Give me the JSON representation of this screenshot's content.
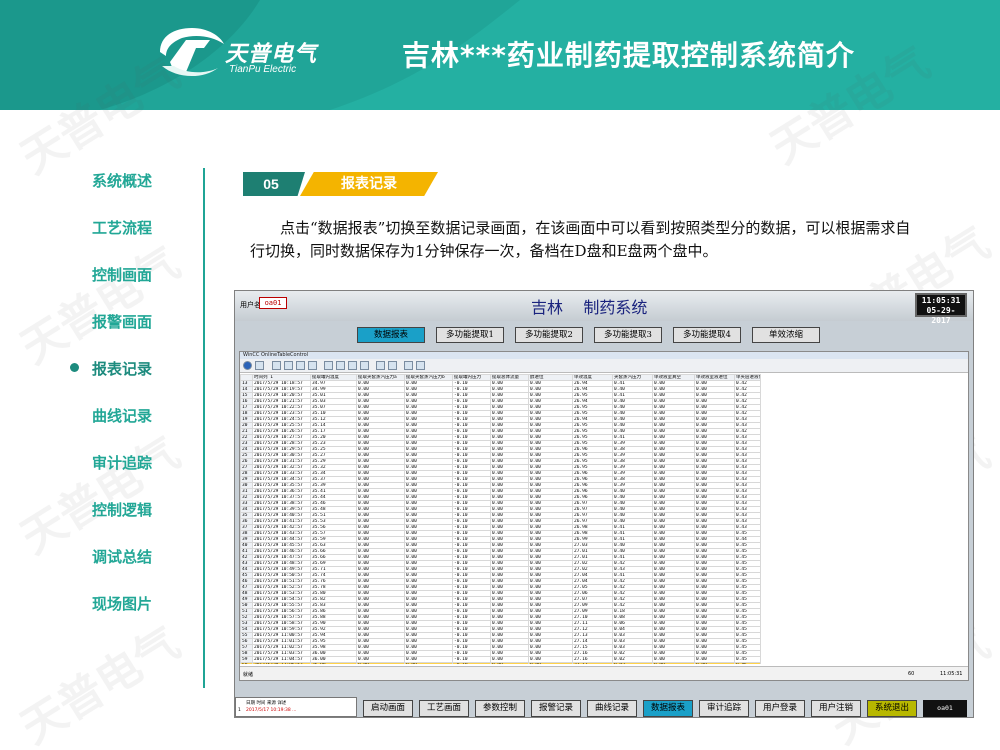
{
  "slide": {
    "title": "吉林***药业制药提取控制系统简介",
    "logo_name": "天普电气",
    "logo_sub": "TianPu Electric",
    "watermark": "天普电气",
    "section_number": "05",
    "section_title": "报表记录",
    "paragraph": "点击“数据报表”切换至数据记录画面，在该画面中可以看到按照类型分的数据，可以根据需求自行切换，同时数据保存为1分钟保存一次，备档在D盘和E盘两个盘中。",
    "accent_color": "#24b0a2",
    "section_color": "#f4b400"
  },
  "nav": {
    "items": [
      {
        "label": "系统概述",
        "active": false
      },
      {
        "label": "工艺流程",
        "active": false
      },
      {
        "label": "控制画面",
        "active": false
      },
      {
        "label": "报警画面",
        "active": false
      },
      {
        "label": "报表记录",
        "active": true
      },
      {
        "label": "曲线记录",
        "active": false
      },
      {
        "label": "审计追踪",
        "active": false
      },
      {
        "label": "控制逻辑",
        "active": false
      },
      {
        "label": "调试总结",
        "active": false
      },
      {
        "label": "现场图片",
        "active": false
      }
    ]
  },
  "app": {
    "user_label": "用户名",
    "user_value": "oa01",
    "title": "吉林    制药系统",
    "clock_time": "11:05:31",
    "clock_date": "05-29-2017",
    "menu_buttons": [
      "数据报表",
      "多功能提取1",
      "多功能提取2",
      "多功能提取3",
      "多功能提取4",
      "单效浓缩"
    ],
    "menu_selected": 0,
    "control_title": "WinCC OnlineTableControl",
    "columns": [
      "时间列 1",
      "提取罐内温度",
      "提取夹套蒸汽压力a",
      "提取夹套蒸汽压力b",
      "提取罐内压力",
      "提取总体流量",
      "醇进位",
      "单效温度",
      "夹套蒸汽压力",
      "单效液室真空",
      "单效液室液进位",
      "单夹层进液位"
    ],
    "rows": [
      [
        "13",
        "2017/5/29 10:18:57",
        "34.97",
        "0.00",
        "0.00",
        "-0.10",
        "0.00",
        "0.00",
        "26.94",
        "0.41",
        "0.00",
        "0.00",
        "0.42"
      ],
      [
        "14",
        "2017/5/29 10:19:57",
        "34.99",
        "0.00",
        "0.00",
        "-0.10",
        "0.00",
        "0.00",
        "26.94",
        "0.40",
        "0.00",
        "0.00",
        "0.42"
      ],
      [
        "15",
        "2017/5/29 10:20:57",
        "35.01",
        "0.00",
        "0.00",
        "-0.10",
        "0.00",
        "0.00",
        "26.95",
        "0.41",
        "0.00",
        "0.00",
        "0.42"
      ],
      [
        "16",
        "2017/5/29 10:21:57",
        "35.03",
        "0.00",
        "0.00",
        "-0.10",
        "0.00",
        "0.00",
        "26.94",
        "0.40",
        "0.00",
        "0.00",
        "0.42"
      ],
      [
        "17",
        "2017/5/29 10:22:57",
        "35.07",
        "0.00",
        "0.00",
        "-0.10",
        "0.00",
        "0.00",
        "26.95",
        "0.40",
        "0.00",
        "0.00",
        "0.42"
      ],
      [
        "18",
        "2017/5/29 10:23:57",
        "35.10",
        "0.00",
        "0.00",
        "-0.10",
        "0.00",
        "0.00",
        "26.95",
        "0.40",
        "0.00",
        "0.00",
        "0.42"
      ],
      [
        "19",
        "2017/5/29 10:24:57",
        "35.12",
        "0.00",
        "0.00",
        "-0.10",
        "0.00",
        "0.00",
        "26.94",
        "0.40",
        "0.00",
        "0.00",
        "0.43"
      ],
      [
        "20",
        "2017/5/29 10:25:57",
        "35.14",
        "0.00",
        "0.00",
        "-0.10",
        "0.00",
        "0.00",
        "26.95",
        "0.40",
        "0.00",
        "0.00",
        "0.43"
      ],
      [
        "21",
        "2017/5/29 10:26:57",
        "35.17",
        "0.00",
        "0.00",
        "-0.10",
        "0.00",
        "0.00",
        "26.95",
        "0.40",
        "0.00",
        "0.00",
        "0.42"
      ],
      [
        "22",
        "2017/5/29 10:27:57",
        "35.20",
        "0.00",
        "0.00",
        "-0.10",
        "0.00",
        "0.00",
        "26.95",
        "0.41",
        "0.00",
        "0.00",
        "0.43"
      ],
      [
        "23",
        "2017/5/29 10:28:57",
        "35.23",
        "0.00",
        "0.00",
        "-0.10",
        "0.00",
        "0.00",
        "26.95",
        "0.39",
        "0.00",
        "0.00",
        "0.43"
      ],
      [
        "24",
        "2017/5/29 10:29:57",
        "35.25",
        "0.00",
        "0.00",
        "-0.10",
        "0.00",
        "0.00",
        "26.96",
        "0.38",
        "0.00",
        "0.00",
        "0.43"
      ],
      [
        "25",
        "2017/5/29 10:30:57",
        "35.27",
        "0.00",
        "0.00",
        "-0.10",
        "0.00",
        "0.00",
        "26.95",
        "0.39",
        "0.00",
        "0.00",
        "0.43"
      ],
      [
        "26",
        "2017/5/29 10:31:57",
        "35.29",
        "0.00",
        "0.00",
        "-0.10",
        "0.00",
        "0.00",
        "26.95",
        "0.38",
        "0.00",
        "0.00",
        "0.43"
      ],
      [
        "27",
        "2017/5/29 10:32:57",
        "35.32",
        "0.00",
        "0.00",
        "-0.10",
        "0.00",
        "0.00",
        "26.95",
        "0.39",
        "0.00",
        "0.00",
        "0.43"
      ],
      [
        "28",
        "2017/5/29 10:33:57",
        "35.34",
        "0.00",
        "0.00",
        "-0.10",
        "0.00",
        "0.00",
        "26.96",
        "0.39",
        "0.00",
        "0.00",
        "0.43"
      ],
      [
        "29",
        "2017/5/29 10:34:57",
        "35.37",
        "0.00",
        "0.00",
        "-0.10",
        "0.00",
        "0.00",
        "26.96",
        "0.38",
        "0.00",
        "0.00",
        "0.43"
      ],
      [
        "30",
        "2017/5/29 10:35:57",
        "35.39",
        "0.00",
        "0.00",
        "-0.10",
        "0.00",
        "0.00",
        "26.96",
        "0.39",
        "0.00",
        "0.00",
        "0.43"
      ],
      [
        "31",
        "2017/5/29 10:36:57",
        "35.41",
        "0.00",
        "0.00",
        "-0.10",
        "0.00",
        "0.00",
        "26.96",
        "0.40",
        "0.00",
        "0.00",
        "0.43"
      ],
      [
        "32",
        "2017/5/29 10:37:57",
        "35.44",
        "0.00",
        "0.00",
        "-0.10",
        "0.00",
        "0.00",
        "26.96",
        "0.40",
        "0.00",
        "0.00",
        "0.43"
      ],
      [
        "33",
        "2017/5/29 10:38:57",
        "35.46",
        "0.00",
        "0.00",
        "-0.10",
        "0.00",
        "0.00",
        "26.97",
        "0.40",
        "0.00",
        "0.00",
        "0.43"
      ],
      [
        "34",
        "2017/5/29 10:39:57",
        "35.48",
        "0.00",
        "0.00",
        "-0.10",
        "0.00",
        "0.00",
        "26.97",
        "0.40",
        "0.00",
        "0.00",
        "0.43"
      ],
      [
        "35",
        "2017/5/29 10:40:57",
        "35.51",
        "0.00",
        "0.00",
        "-0.10",
        "0.00",
        "0.00",
        "26.97",
        "0.40",
        "0.00",
        "0.00",
        "0.43"
      ],
      [
        "36",
        "2017/5/29 10:41:57",
        "35.53",
        "0.00",
        "0.00",
        "-0.10",
        "0.00",
        "0.00",
        "26.97",
        "0.40",
        "0.00",
        "0.00",
        "0.43"
      ],
      [
        "37",
        "2017/5/29 10:42:57",
        "35.56",
        "0.00",
        "0.00",
        "-0.10",
        "0.00",
        "0.00",
        "26.98",
        "0.41",
        "0.00",
        "0.00",
        "0.43"
      ],
      [
        "38",
        "2017/5/29 10:43:57",
        "35.57",
        "0.00",
        "0.00",
        "-0.10",
        "0.00",
        "0.00",
        "26.98",
        "0.41",
        "0.00",
        "0.00",
        "0.45"
      ],
      [
        "39",
        "2017/5/29 10:44:57",
        "35.59",
        "0.00",
        "0.00",
        "-0.10",
        "0.00",
        "0.00",
        "26.99",
        "0.41",
        "0.00",
        "0.00",
        "0.44"
      ],
      [
        "40",
        "2017/5/29 10:45:57",
        "35.63",
        "0.00",
        "0.00",
        "-0.10",
        "0.00",
        "0.00",
        "27.03",
        "0.40",
        "0.00",
        "0.00",
        "0.45"
      ],
      [
        "41",
        "2017/5/29 10:46:57",
        "35.66",
        "0.00",
        "0.00",
        "-0.10",
        "0.00",
        "0.00",
        "27.01",
        "0.40",
        "0.00",
        "0.00",
        "0.45"
      ],
      [
        "42",
        "2017/5/29 10:47:57",
        "35.66",
        "0.00",
        "0.00",
        "-0.10",
        "0.00",
        "0.00",
        "27.01",
        "0.41",
        "0.00",
        "0.00",
        "0.45"
      ],
      [
        "43",
        "2017/5/29 10:48:57",
        "35.69",
        "0.00",
        "0.00",
        "-0.10",
        "0.00",
        "0.00",
        "27.02",
        "0.42",
        "0.00",
        "0.00",
        "0.45"
      ],
      [
        "44",
        "2017/5/29 10:49:57",
        "35.71",
        "0.00",
        "0.00",
        "-0.10",
        "0.00",
        "0.00",
        "27.02",
        "0.43",
        "0.00",
        "0.00",
        "0.45"
      ],
      [
        "45",
        "2017/5/29 10:50:57",
        "35.74",
        "0.00",
        "0.00",
        "-0.10",
        "0.00",
        "0.00",
        "27.04",
        "0.41",
        "0.00",
        "0.00",
        "0.45"
      ],
      [
        "46",
        "2017/5/29 10:51:57",
        "35.76",
        "0.00",
        "0.00",
        "-0.10",
        "0.00",
        "0.00",
        "27.04",
        "0.42",
        "0.00",
        "0.00",
        "0.45"
      ],
      [
        "47",
        "2017/5/29 10:52:57",
        "35.78",
        "0.00",
        "0.00",
        "-0.10",
        "0.00",
        "0.00",
        "27.05",
        "0.42",
        "0.00",
        "0.00",
        "0.45"
      ],
      [
        "48",
        "2017/5/29 10:53:57",
        "35.80",
        "0.00",
        "0.00",
        "-0.10",
        "0.00",
        "0.00",
        "27.06",
        "0.42",
        "0.00",
        "0.00",
        "0.45"
      ],
      [
        "49",
        "2017/5/29 10:54:57",
        "35.82",
        "0.00",
        "0.00",
        "-0.10",
        "0.00",
        "0.00",
        "27.07",
        "0.42",
        "0.00",
        "0.00",
        "0.45"
      ],
      [
        "50",
        "2017/5/29 10:55:57",
        "35.83",
        "0.00",
        "0.00",
        "-0.10",
        "0.00",
        "0.00",
        "27.09",
        "0.42",
        "0.00",
        "0.00",
        "0.45"
      ],
      [
        "51",
        "2017/5/29 10:56:57",
        "35.86",
        "0.00",
        "0.00",
        "-0.10",
        "0.00",
        "0.00",
        "27.09",
        "0.18",
        "0.00",
        "0.00",
        "0.45"
      ],
      [
        "52",
        "2017/5/29 10:57:57",
        "35.88",
        "0.00",
        "0.00",
        "-0.10",
        "0.00",
        "0.00",
        "27.10",
        "0.08",
        "0.00",
        "0.00",
        "0.45"
      ],
      [
        "53",
        "2017/5/29 10:58:57",
        "35.90",
        "0.00",
        "0.00",
        "-0.10",
        "0.00",
        "0.00",
        "27.11",
        "0.06",
        "0.00",
        "0.00",
        "0.45"
      ],
      [
        "54",
        "2017/5/29 10:59:57",
        "35.92",
        "0.00",
        "0.00",
        "-0.10",
        "0.00",
        "0.00",
        "27.12",
        "0.04",
        "0.00",
        "0.00",
        "0.45"
      ],
      [
        "55",
        "2017/5/29 11:00:57",
        "35.94",
        "0.00",
        "0.00",
        "-0.10",
        "0.00",
        "0.00",
        "27.13",
        "0.03",
        "0.00",
        "0.00",
        "0.45"
      ],
      [
        "56",
        "2017/5/29 11:01:57",
        "35.95",
        "0.00",
        "0.00",
        "-0.10",
        "0.00",
        "0.00",
        "27.14",
        "0.03",
        "0.00",
        "0.00",
        "0.45"
      ],
      [
        "57",
        "2017/5/29 11:02:57",
        "35.98",
        "0.00",
        "0.00",
        "-0.10",
        "0.00",
        "0.00",
        "27.15",
        "0.03",
        "0.00",
        "0.00",
        "0.45"
      ],
      [
        "58",
        "2017/5/29 11:03:57",
        "36.00",
        "0.00",
        "0.00",
        "-0.10",
        "0.00",
        "0.00",
        "27.16",
        "0.02",
        "0.00",
        "0.00",
        "0.45"
      ],
      [
        "59",
        "2017/5/29 11:04:57",
        "36.00",
        "0.00",
        "0.00",
        "-0.10",
        "0.00",
        "0.00",
        "27.16",
        "0.02",
        "0.00",
        "0.00",
        "0.45"
      ],
      [
        "60",
        "2017/5/29 11:05:57",
        "36.00",
        "0.00",
        "0.00",
        "-0.10",
        "0.00",
        "0.00",
        "27.17",
        "0.02",
        "0.00",
        "0.00",
        "0.45"
      ]
    ],
    "selected_row": 47,
    "status_left": "就绪",
    "status_count": "60",
    "status_time": "11:05:31",
    "alarm_headers": [
      "日期",
      "时间",
      "来源",
      "详述"
    ],
    "alarm_row": "2017/5/17  10:19:38 ...",
    "alarm_mark": "1",
    "nav_buttons": [
      "启动画面",
      "工艺画面",
      "参数控制",
      "报警记录",
      "曲线记录",
      "数据报表",
      "审计追踪",
      "用户登录",
      "用户注销",
      "系统退出"
    ],
    "nav_selected": 5,
    "operator": "oa01"
  }
}
